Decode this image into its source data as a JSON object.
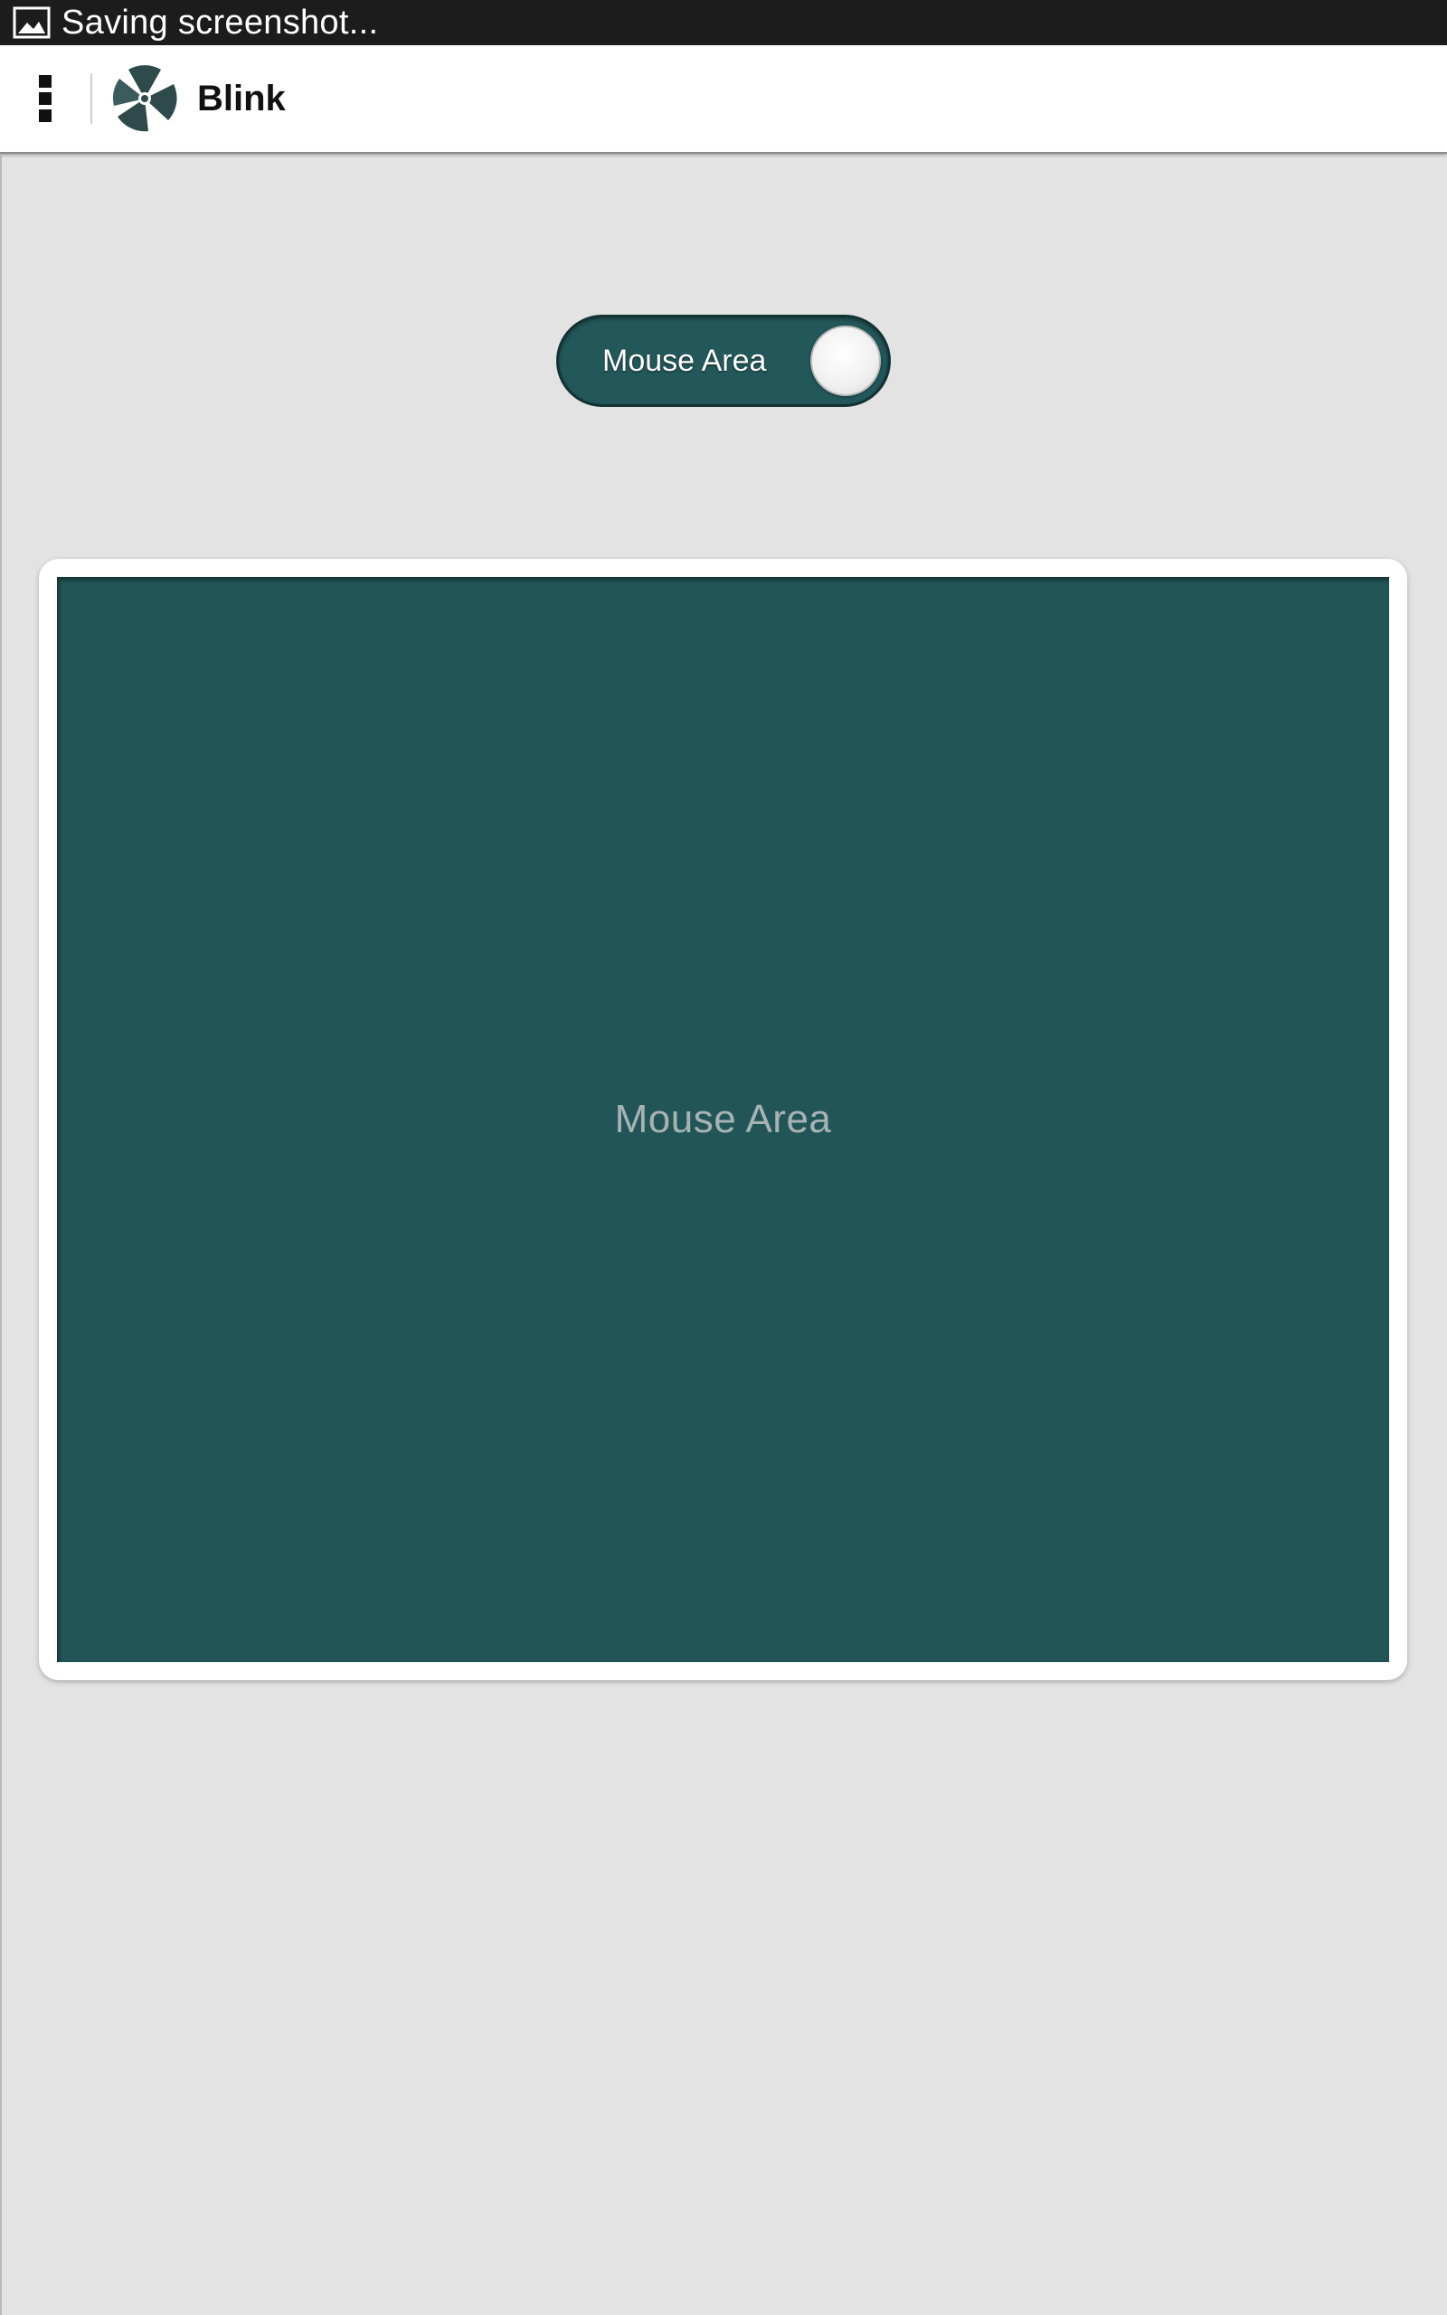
{
  "status_bar": {
    "notification_icon": "image-icon",
    "text": "Saving screenshot..."
  },
  "action_bar": {
    "menu_icon": "overflow-menu-icon",
    "logo_icon": "blink-logo-icon",
    "title": "Blink"
  },
  "toggle": {
    "label": "Mouse Area",
    "state": "on",
    "track_color": "#23585a"
  },
  "mouse_area": {
    "label": "Mouse Area",
    "color": "#225557"
  }
}
